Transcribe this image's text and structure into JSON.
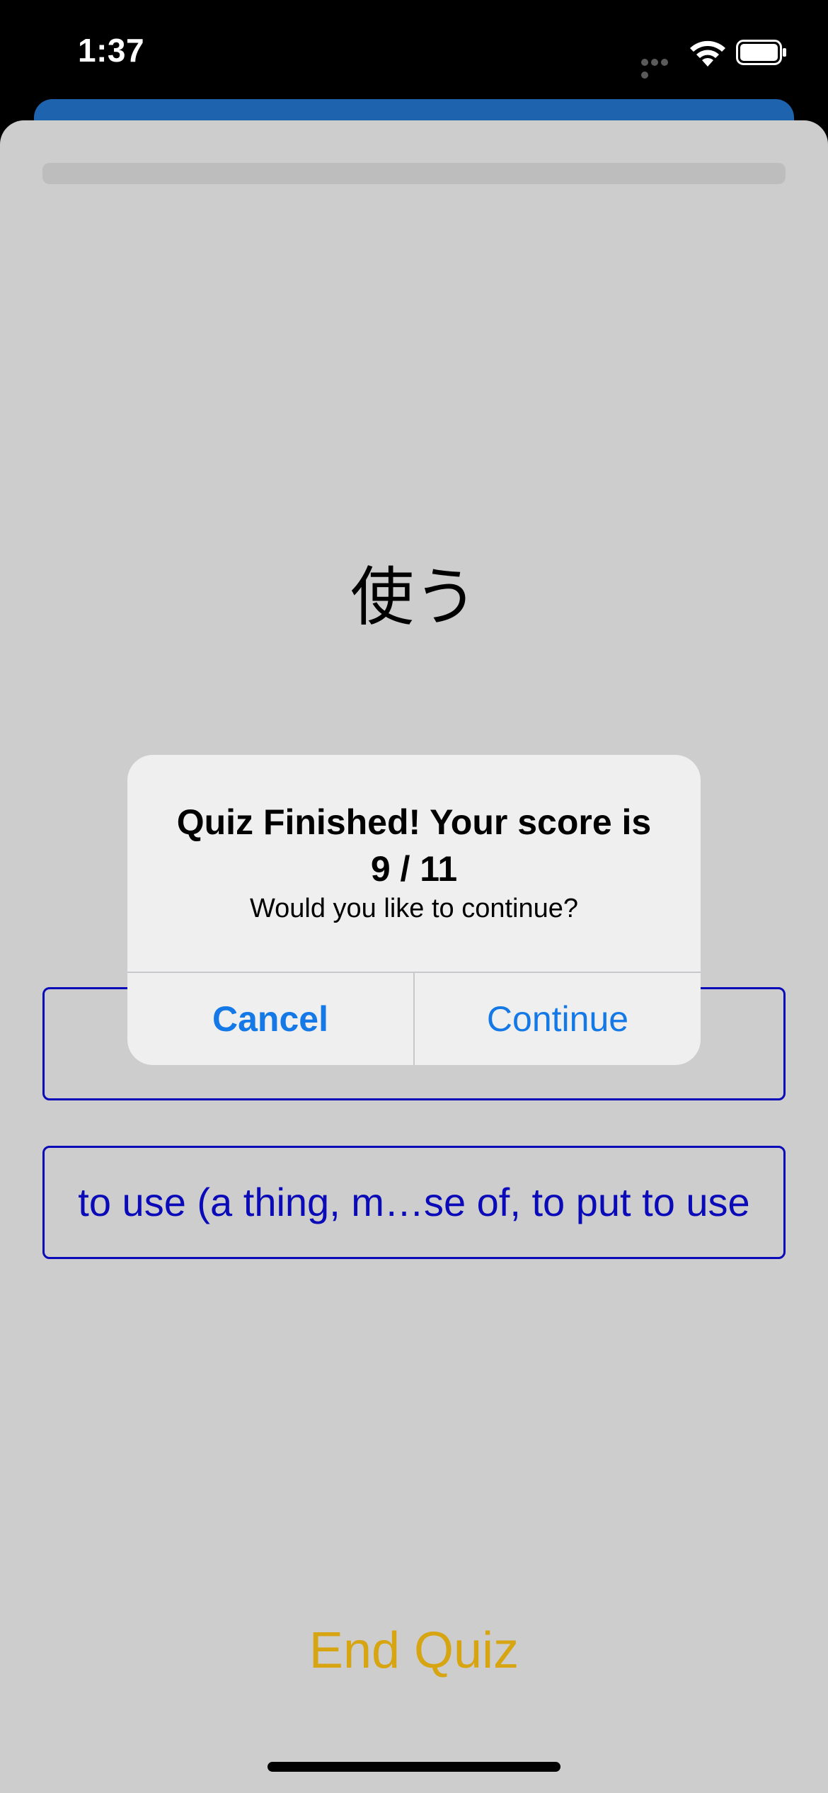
{
  "status_bar": {
    "time": "1:37",
    "icons": [
      "cellular-signal-icon",
      "wifi-icon",
      "battery-icon"
    ]
  },
  "quiz": {
    "progress": 1.0,
    "question_word": "使う",
    "answers": [
      "",
      "to use (a thing, m…se of, to put to use"
    ],
    "end_quiz_label": "End Quiz"
  },
  "alert": {
    "title_line1": "Quiz Finished! Your score is",
    "title_line2": "9 / 11",
    "message": "Would you like to continue?",
    "cancel_label": "Cancel",
    "continue_label": "Continue"
  },
  "colors": {
    "accent_blue": "#1479e6",
    "answer_blue": "#0a0ab8",
    "end_quiz_gold": "#d7a511",
    "back_sheet_blue": "#1d63ae",
    "sheet_gray": "#cdcdcd"
  }
}
